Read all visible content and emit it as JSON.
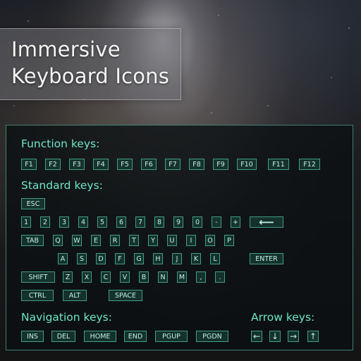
{
  "title": {
    "line1": "Immersive",
    "line2": "Keyboard Icons"
  },
  "sections": {
    "function": "Function keys:",
    "standard": "Standard keys:",
    "navigation": "Navigation keys:",
    "arrow": "Arrow keys:"
  },
  "function_keys": [
    "F1",
    "F2",
    "F3",
    "F4",
    "F5",
    "F6",
    "F7",
    "F8",
    "F9",
    "F10",
    "F11",
    "F12"
  ],
  "esc_row": [
    "ESC"
  ],
  "number_row": [
    "1",
    "2",
    "3",
    "4",
    "5",
    "6",
    "7",
    "8",
    "9",
    "0",
    "-",
    "+",
    "⟵"
  ],
  "qwerty_row": [
    "TAB",
    "Q",
    "W",
    "E",
    "R",
    "T",
    "Y",
    "U",
    "I",
    "O",
    "P"
  ],
  "asdf_row": [
    "A",
    "S",
    "D",
    "F",
    "G",
    "H",
    "J",
    "K",
    "L",
    "ENTER"
  ],
  "zxcv_row": [
    "SHIFT",
    "Z",
    "X",
    "C",
    "V",
    "B",
    "N",
    "M",
    ",",
    "."
  ],
  "bottom_row": [
    "CTRL",
    "ALT",
    "SPACE"
  ],
  "navigation_keys": [
    "INS",
    "DEL",
    "HOME",
    "END",
    "PGUP",
    "PGDN"
  ],
  "arrow_keys": [
    "←",
    "↓",
    "→",
    "↑"
  ],
  "arrow_icon_names": [
    "left-arrow-icon",
    "down-arrow-icon",
    "right-arrow-icon",
    "up-arrow-icon"
  ],
  "colors": {
    "accent": "#6ee6c8",
    "key_border": "#3f9d86",
    "key_text": "#bff3e4",
    "panel_border": "#3f7f73"
  }
}
